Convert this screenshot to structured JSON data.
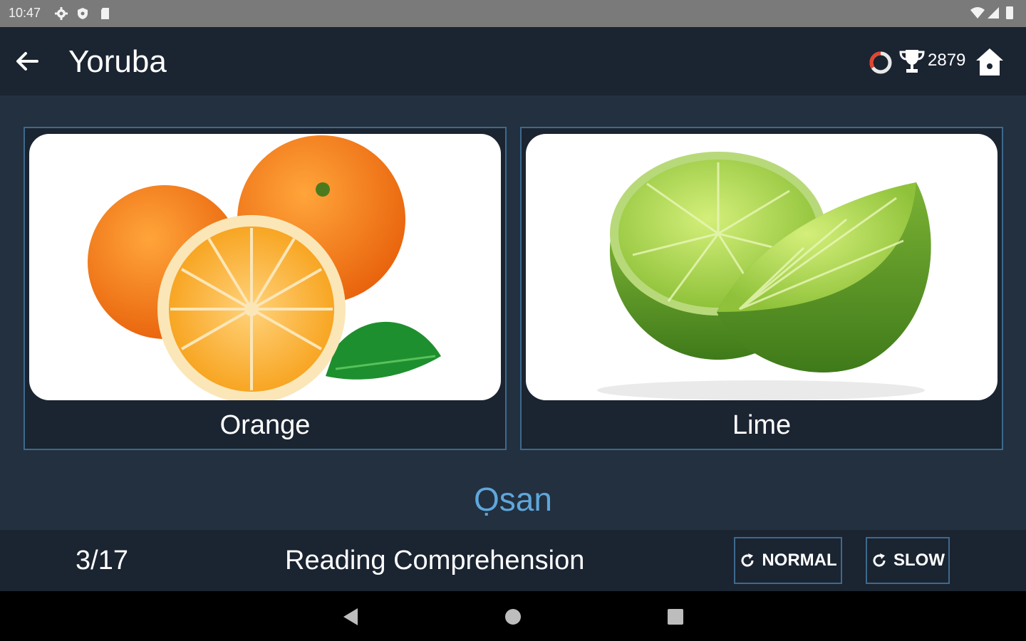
{
  "status_bar": {
    "time": "10:47",
    "left_icons": [
      "settings-icon",
      "shield-icon",
      "sd-card-icon"
    ],
    "right_icons": [
      "wifi-icon",
      "signal-icon",
      "battery-icon"
    ]
  },
  "app_bar": {
    "title": "Yoruba",
    "back_icon": "arrow-left-icon",
    "streak_icon": "ring-icon",
    "trophy_icon": "trophy-icon",
    "score": "2879",
    "home_icon": "home-icon"
  },
  "cards": [
    {
      "label": "Orange",
      "image": "oranges-photo"
    },
    {
      "label": "Lime",
      "image": "limes-photo"
    }
  ],
  "prompt_word": "Ọsan",
  "bottom_bar": {
    "progress": "3/17",
    "mode": "Reading Comprehension",
    "normal_label": "NORMAL",
    "slow_label": "SLOW"
  },
  "nav_bar": {
    "back": "nav-back-icon",
    "home": "nav-home-icon",
    "recents": "nav-recents-icon"
  },
  "colors": {
    "accent": "#5fa7dc",
    "card_border": "#3d6a8e",
    "bar_bg": "#1b2431",
    "main_bg": "#233040"
  }
}
